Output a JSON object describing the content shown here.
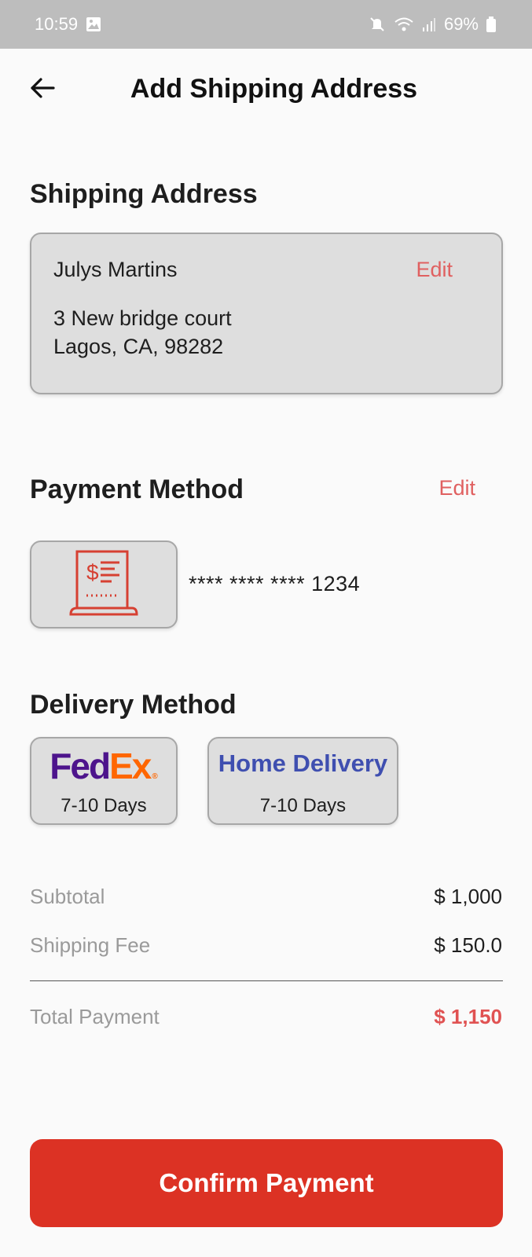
{
  "status_bar": {
    "time": "10:59",
    "battery": "69%"
  },
  "header": {
    "title": "Add Shipping Address",
    "back_icon": "arrow-left-icon"
  },
  "shipping": {
    "title": "Shipping Address",
    "name": "Julys Martins",
    "edit_label": "Edit",
    "address_line1": "3 New bridge court",
    "address_line2": "Lagos, CA, 98282"
  },
  "payment": {
    "title": "Payment Method",
    "edit_label": "Edit",
    "card_icon": "receipt-icon",
    "card_number": "**** **** **** 1234"
  },
  "delivery": {
    "title": "Delivery Method",
    "options": [
      {
        "logo_fed": "Fed",
        "logo_ex": "Ex",
        "logo_mark": "®",
        "days": "7-10 Days"
      },
      {
        "label": "Home Delivery",
        "days": "7-10 Days"
      }
    ]
  },
  "summary": {
    "subtotal_label": "Subtotal",
    "subtotal_value": "$ 1,000",
    "shipping_label": "Shipping Fee",
    "shipping_value": "$ 150.0",
    "total_label": "Total Payment",
    "total_value": "$ 1,150"
  },
  "actions": {
    "confirm_label": "Confirm Payment"
  },
  "colors": {
    "accent": "#dc3224",
    "edit": "#e06060",
    "home_delivery": "#3f4fb0",
    "fedex_purple": "#4d148c",
    "fedex_orange": "#ff6600"
  }
}
